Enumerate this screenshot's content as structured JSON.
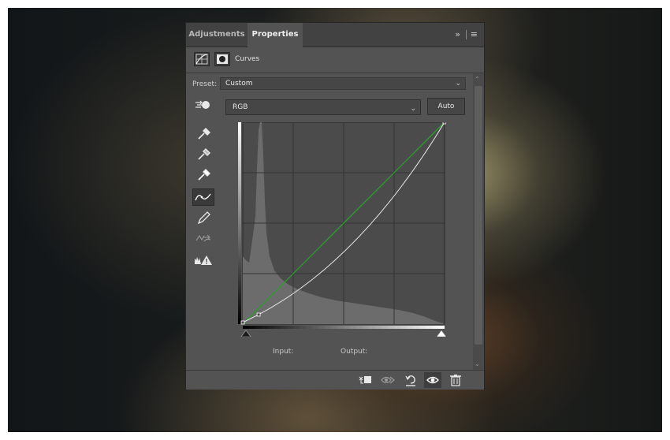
{
  "tabs": [
    {
      "label": "Adjustments",
      "active": false
    },
    {
      "label": "Properties",
      "active": true
    }
  ],
  "header": {
    "title": "Curves",
    "icons": [
      "curves-adjustment-icon",
      "layer-mask-icon"
    ]
  },
  "preset": {
    "label": "Preset:",
    "value": "Custom"
  },
  "channel": {
    "value": "RGB"
  },
  "auto_button": {
    "label": "Auto"
  },
  "tools": [
    "on-image-adjust-icon",
    "black-point-eyedropper-icon",
    "gray-point-eyedropper-icon",
    "white-point-eyedropper-icon",
    "edit-points-icon",
    "draw-curve-icon",
    "smooth-curve-icon",
    "clipping-warning-icon"
  ],
  "io": {
    "input_label": "Input:",
    "output_label": "Output:"
  },
  "footer_buttons": [
    "clip-to-layer-icon",
    "view-previous-state-icon",
    "reset-icon",
    "visibility-eye-icon",
    "delete-trash-icon"
  ],
  "colors": {
    "panel": "#535353",
    "curve": "#e6e6e6",
    "baseline": "#2aa02a",
    "histogram": "#6c6c6c"
  },
  "curve": {
    "baseline": [
      [
        0,
        0
      ],
      [
        255,
        255
      ]
    ],
    "points": [
      [
        0,
        2
      ],
      [
        20,
        12
      ],
      [
        255,
        255
      ]
    ]
  }
}
